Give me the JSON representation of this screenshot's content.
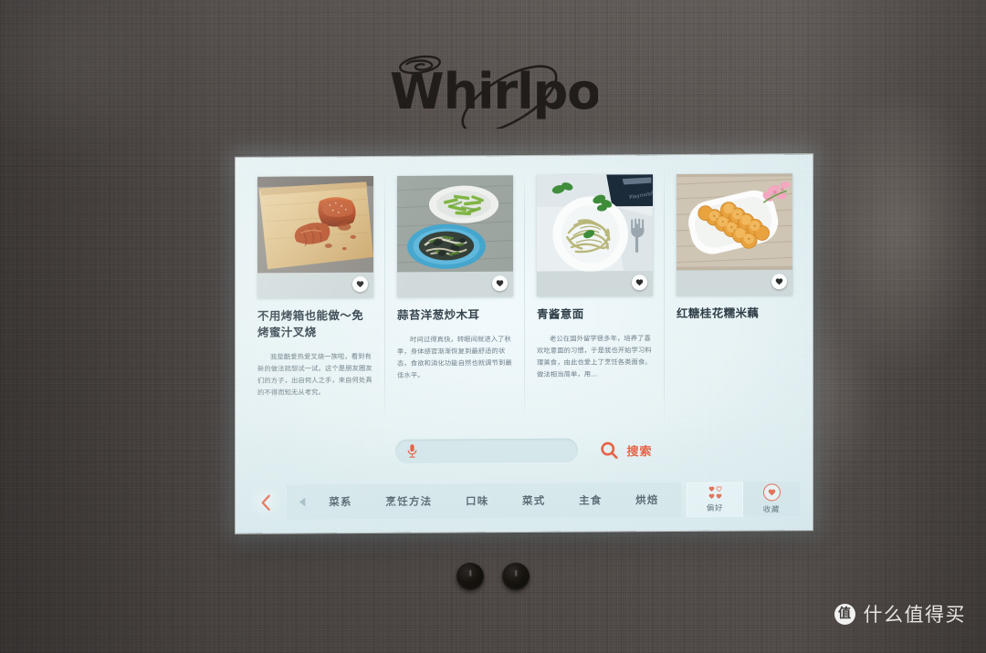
{
  "brand": {
    "name": "Whirlpool",
    "logo_icon": "whirlpool-swirl-icon"
  },
  "screen": {
    "cards": [
      {
        "title": "不用烤箱也能做～免烤蜜汁叉烧",
        "desc": "我是酷爱热爱叉烧一族啦，看到有新的做法就想试一试。这个是朋友圈友们的方子，出自何人之手，来自何处真的不得而知无从考究。",
        "photo_alt": "honey-glazed-char-siu-on-wooden-board",
        "fav_icon": "heart-icon"
      },
      {
        "title": "蒜苔洋葱炒木耳",
        "desc": "时间过得真快，转眼间就进入了秋季，身体感官渐渐恢复到最舒适的状态，食欲和消化功能自然也就调节到最佳水平。",
        "photo_alt": "garlic-scape-onion-wood-ear-stirfry-blue-plate",
        "fav_icon": "heart-icon"
      },
      {
        "title": "青酱意面",
        "desc": "老公在国外留学很多年，培养了喜欢吃意面的习惯，于是我也开始学习料理美食，由此也爱上了烹饪各类面食。做法相当简单，用…",
        "photo_alt": "green-pesto-pasta-white-plate-basil",
        "fav_icon": "heart-icon"
      },
      {
        "title": "红糖桂花糯米藕",
        "desc": "",
        "photo_alt": "brown-sugar-osmanthus-glutinous-rice-lotus-root",
        "fav_icon": "heart-icon"
      }
    ],
    "search": {
      "mic_icon": "microphone-icon",
      "input_value": "",
      "placeholder": "",
      "search_icon": "magnifier-icon",
      "search_label": "搜索"
    },
    "bottom_bar": {
      "back_icon": "chevron-left-icon",
      "prev_icon": "triangle-left-icon",
      "nav_items": [
        {
          "label": "菜系"
        },
        {
          "label": "烹饪方法"
        },
        {
          "label": "口味"
        },
        {
          "label": "菜式"
        },
        {
          "label": "主食"
        },
        {
          "label": "烘焙"
        }
      ],
      "side_actions": [
        {
          "label": "偏好",
          "icon": "hearts-grid-icon",
          "active": true
        },
        {
          "label": "收藏",
          "icon": "heart-circle-icon",
          "active": false
        }
      ]
    }
  },
  "watermark": {
    "badge": "值",
    "text": "什么值得买"
  },
  "colors": {
    "accent_red": "#e8593a",
    "door": "#58514e",
    "screen_bg": "#e6f2f5",
    "title_text": "#30404a"
  }
}
